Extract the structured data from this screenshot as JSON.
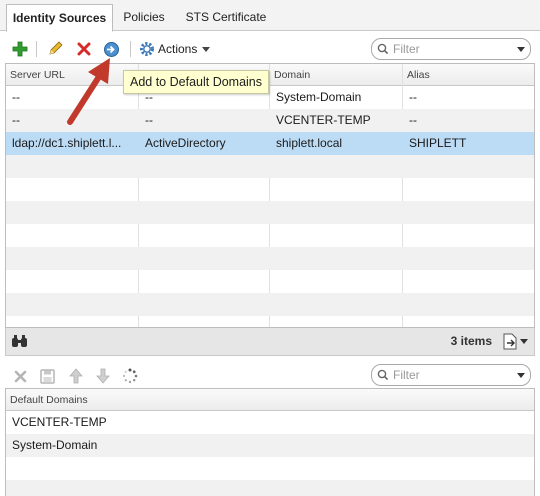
{
  "tabs": [
    {
      "label": "Identity Sources",
      "active": true
    },
    {
      "label": "Policies",
      "active": false
    },
    {
      "label": "STS Certificate",
      "active": false
    }
  ],
  "toolbar": {
    "icons": [
      "add-icon",
      "edit-icon",
      "delete-icon",
      "add-to-default-domains-icon",
      "gear-icon"
    ],
    "actions_label": "Actions",
    "filter_placeholder": "Filter"
  },
  "tooltip": "Add to Default Domains",
  "identity_grid": {
    "columns": [
      "Server URL",
      "",
      "Domain",
      "Alias"
    ],
    "rows": [
      {
        "server_url": "--",
        "type": "--",
        "domain": "System-Domain",
        "alias": "--",
        "selected": false
      },
      {
        "server_url": "--",
        "type": "--",
        "domain": "VCENTER-TEMP",
        "alias": "--",
        "selected": false
      },
      {
        "server_url": "ldap://dc1.shiplett.l...",
        "type": "ActiveDirectory",
        "domain": "shiplett.local",
        "alias": "SHIPLETT",
        "selected": true
      }
    ],
    "items_count": "3 items"
  },
  "lower_toolbar": {
    "icons": [
      "remove-icon",
      "save-icon",
      "move-up-icon",
      "move-down-icon",
      "refresh-spinner-icon"
    ],
    "filter_placeholder": "Filter"
  },
  "default_domains": {
    "header": "Default Domains",
    "rows": [
      "VCENTER-TEMP",
      "System-Domain"
    ]
  },
  "colors": {
    "selection": "#bcdcf6",
    "annotation_arrow": "#c0392b",
    "tooltip_bg": "#ffffcf"
  }
}
